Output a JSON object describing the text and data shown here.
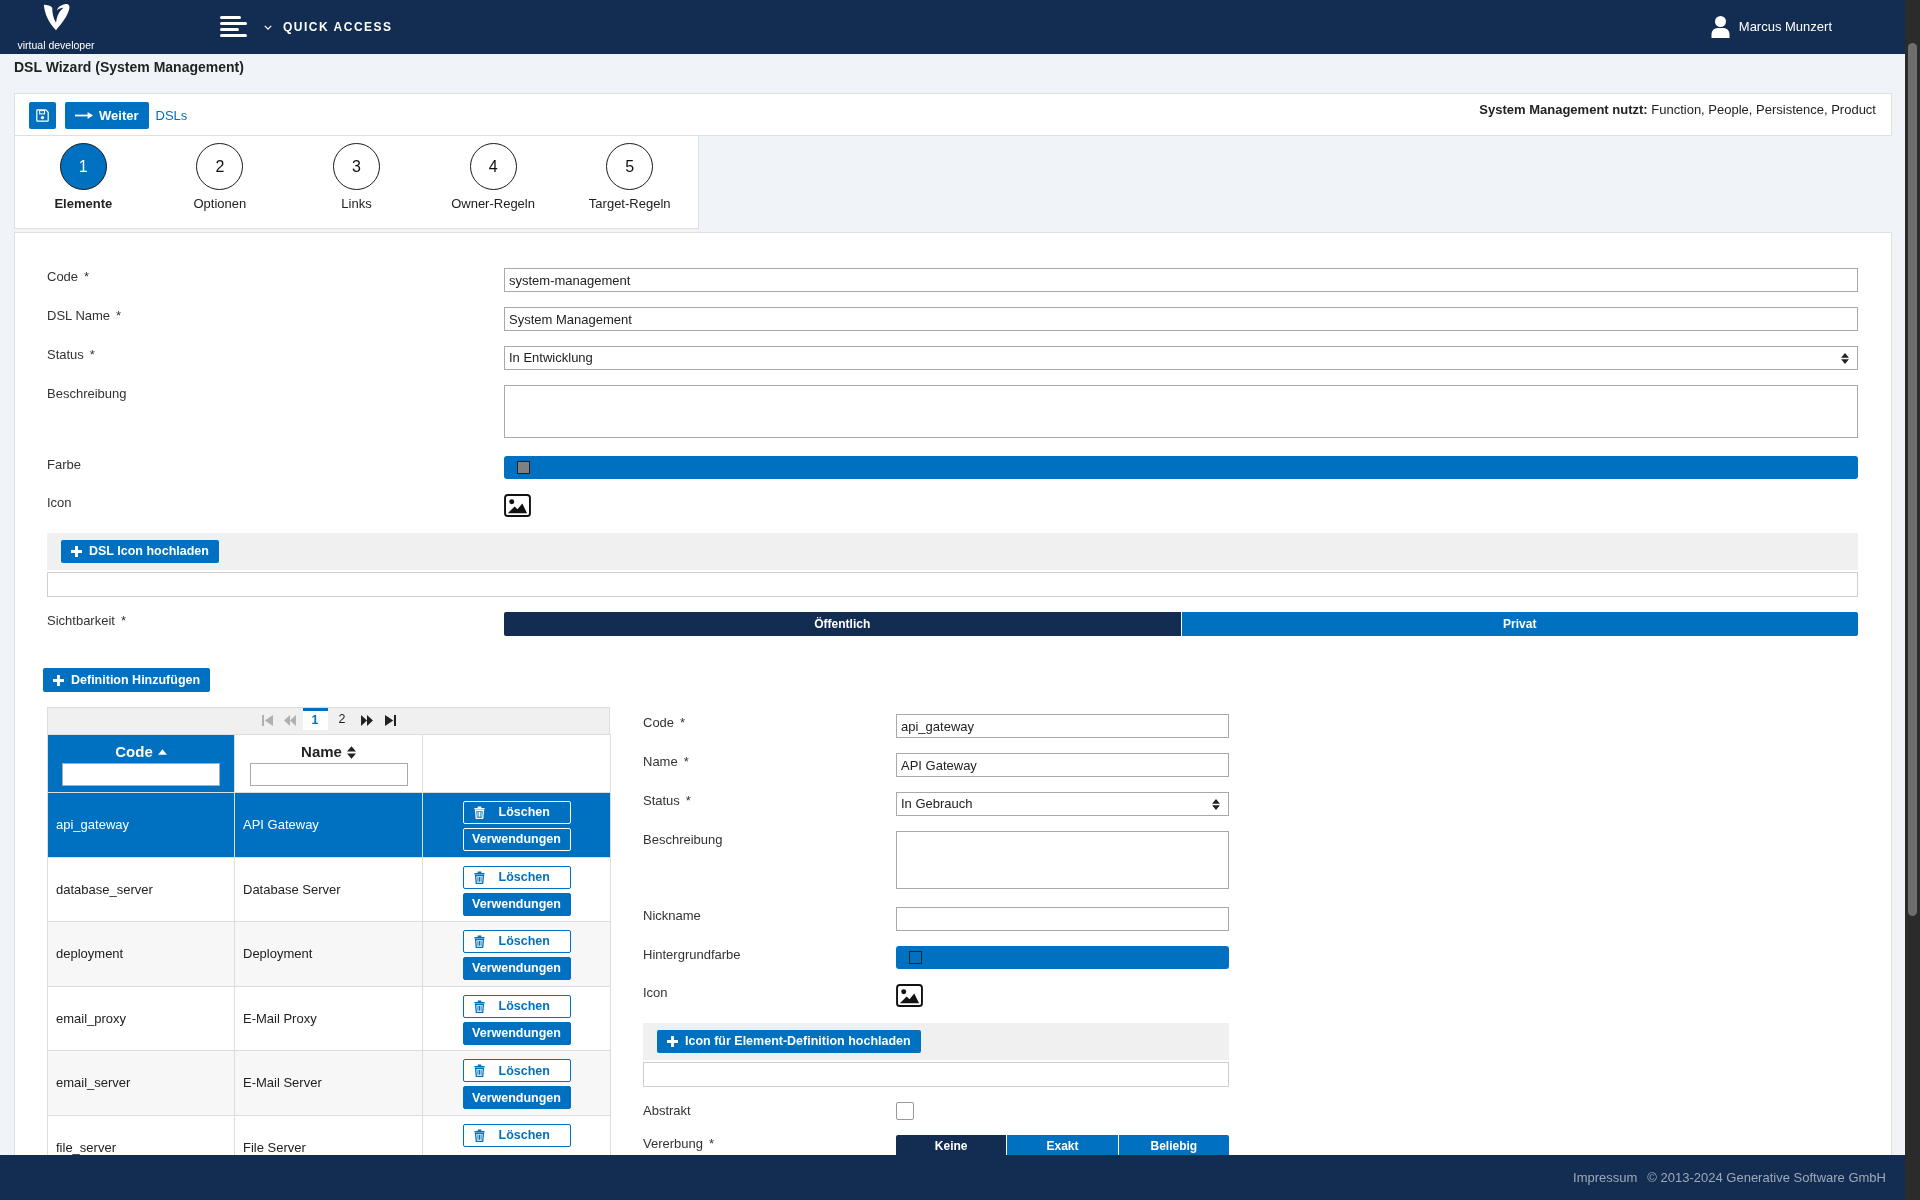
{
  "header": {
    "logo_text": "virtual developer",
    "menu_label": "QUICK ACCESS",
    "user_name": "Marcus Munzert"
  },
  "page_title": "DSL Wizard (System Management)",
  "toolbar": {
    "next_button": "Weiter",
    "link": "DSLs",
    "usage": "**System Management nutzt:** Function, People, Persistence, Product"
  },
  "steps": [
    {
      "number": "1",
      "label": "Elemente",
      "selected": true
    },
    {
      "number": "2",
      "label": "Optionen",
      "selected": false
    },
    {
      "number": "3",
      "label": "Links",
      "selected": false
    },
    {
      "number": "4",
      "label": "Owner-Regeln",
      "selected": false
    },
    {
      "number": "5",
      "label": "Target-Regeln",
      "selected": false
    }
  ],
  "form": {
    "fields": [
      {
        "kind": "text",
        "label": "Code",
        "required_mark": "*",
        "value": "system-management"
      },
      {
        "kind": "text",
        "label": "DSL Name",
        "required_mark": "*",
        "value": "System Management"
      },
      {
        "kind": "select",
        "label": "Status",
        "required_mark": "*",
        "value": "In Entwicklung"
      },
      {
        "kind": "textarea",
        "label": "Beschreibung"
      },
      {
        "kind": "color",
        "label": "Farbe",
        "color": "#808080"
      },
      {
        "kind": "image",
        "label": "Icon"
      },
      {
        "kind": "upload",
        "button": "DSL Icon hochladen"
      },
      {
        "kind": "toggle",
        "label": "Sichtbarkeit",
        "required_mark": "*",
        "options": [
          {
            "label": "Öffentlich",
            "selected": true
          },
          {
            "label": "Privat",
            "selected": false
          }
        ]
      }
    ]
  },
  "definitions": {
    "add_button": "Definition Hinzufügen",
    "pagination": {
      "first": {
        "disabled": true
      },
      "previous": {
        "disabled": true
      },
      "pages": [
        {
          "label": "1",
          "selected": true
        },
        {
          "label": "2",
          "selected": false
        }
      ],
      "next": {
        "disabled": false
      },
      "last": {
        "disabled": false
      }
    },
    "table": {
      "columns": [
        {
          "label": "Code",
          "sorted": true
        },
        {
          "label": "Name",
          "sorted": false
        }
      ],
      "rows": [
        {
          "code": "api_gateway",
          "name": "API Gateway",
          "selected": true,
          "delete_label": "Löschen",
          "usages_label": "Verwendungen"
        },
        {
          "code": "database_server",
          "name": "Database Server",
          "selected": false,
          "delete_label": "Löschen",
          "usages_label": "Verwendungen"
        },
        {
          "code": "deployment",
          "name": "Deployment",
          "selected": false,
          "delete_label": "Löschen",
          "usages_label": "Verwendungen"
        },
        {
          "code": "email_proxy",
          "name": "E-Mail Proxy",
          "selected": false,
          "delete_label": "Löschen",
          "usages_label": "Verwendungen"
        },
        {
          "code": "email_server",
          "name": "E-Mail Server",
          "selected": false,
          "delete_label": "Löschen",
          "usages_label": "Verwendungen"
        },
        {
          "code": "file_server",
          "name": "File Server",
          "selected": false,
          "delete_label": "Löschen"
        }
      ]
    },
    "detail": {
      "fields": [
        {
          "kind": "text",
          "label": "Code",
          "required_mark": "*",
          "value": "api_gateway"
        },
        {
          "kind": "text",
          "label": "Name",
          "required_mark": "*",
          "value": "API Gateway"
        },
        {
          "kind": "select",
          "label": "Status",
          "required_mark": "*",
          "value": "In Gebrauch"
        },
        {
          "kind": "textarea",
          "label": "Beschreibung"
        },
        {
          "kind": "text",
          "label": "Nickname"
        },
        {
          "kind": "color",
          "label": "Hintergrundfarbe"
        },
        {
          "kind": "image",
          "label": "Icon"
        },
        {
          "kind": "upload",
          "button": "Icon für Element-Definition hochladen"
        },
        {
          "kind": "checkbox",
          "label": "Abstrakt",
          "checked": false
        },
        {
          "kind": "toggle",
          "label": "Vererbung",
          "required_mark": "*",
          "options": [
            {
              "label": "Keine",
              "selected": true
            },
            {
              "label": "Exakt",
              "selected": false
            },
            {
              "label": "Beliebig",
              "selected": false
            }
          ]
        }
      ]
    }
  },
  "footer": {
    "link": "Impressum",
    "copyright": "© 2013-2024 Generative Software GmbH"
  }
}
